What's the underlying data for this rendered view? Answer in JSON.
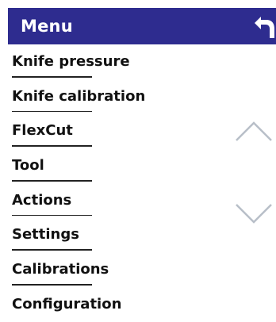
{
  "header": {
    "title": "Menu",
    "back_icon": "return-arrow-icon",
    "background_color": "#2e2c8f",
    "text_color": "#ffffff"
  },
  "menu": {
    "items": [
      {
        "label": "Knife pressure"
      },
      {
        "label": "Knife calibration"
      },
      {
        "label": "FlexCut"
      },
      {
        "label": "Tool"
      },
      {
        "label": "Actions"
      },
      {
        "label": "Settings"
      },
      {
        "label": "Calibrations"
      },
      {
        "label": "Configuration"
      }
    ]
  },
  "scroll": {
    "up_icon": "chevron-up-icon",
    "down_icon": "chevron-down-icon",
    "color": "#b8bfc8"
  }
}
